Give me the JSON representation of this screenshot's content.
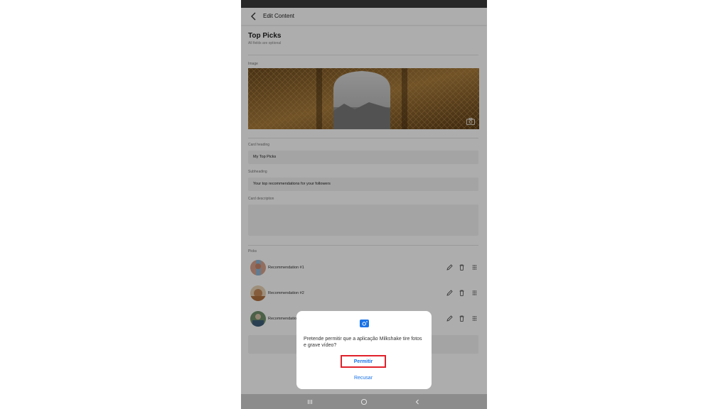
{
  "header": {
    "title": "Edit Content"
  },
  "section": {
    "title": "Top Picks",
    "subtitle": "All fields are optional"
  },
  "image_label": "Image",
  "fields": {
    "card_heading": {
      "label": "Card heading",
      "value": "My Top Picks"
    },
    "subheading": {
      "label": "Subheading",
      "value": "Your top recommendations for your followers"
    },
    "card_description": {
      "label": "Card description",
      "value": ""
    }
  },
  "picks": {
    "label": "Picks",
    "items": [
      {
        "label": "Recommendation #1"
      },
      {
        "label": "Recommendation #2"
      },
      {
        "label": "Recommendation #3"
      }
    ]
  },
  "dialog": {
    "message": "Pretende permitir que a aplicação Milkshake tire fotos e grave vídeo?",
    "allow_label": "Permitir",
    "deny_label": "Recusar"
  },
  "colors": {
    "accent": "#1a73e8",
    "highlight": "#e0212b",
    "overlay": "#000000"
  },
  "icons": {
    "back": "chevron-left-icon",
    "camera": "camera-icon",
    "edit": "pencil-icon",
    "delete": "trash-icon",
    "drag": "drag-handle-icon",
    "dialog": "camera-permission-icon",
    "nav_recents": "recents-icon",
    "nav_home": "home-icon",
    "nav_back": "nav-back-icon"
  }
}
